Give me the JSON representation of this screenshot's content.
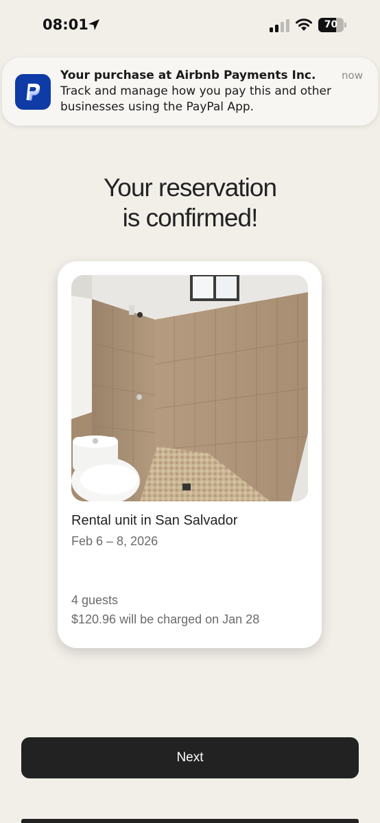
{
  "status_bar": {
    "time": "08:01",
    "battery_level": "70",
    "battery_fraction": 0.7
  },
  "notification": {
    "app": "PayPal",
    "title": "Your purchase at Airbnb Payments Inc.",
    "body": "Track and manage how you pay this and other businesses using the PayPal App.",
    "time": "now",
    "icon": "paypal-logo"
  },
  "heading": {
    "line1": "Your reservation",
    "line2": "is confirmed!"
  },
  "reservation": {
    "photo": "bathroom-shower-photo",
    "title": "Rental unit in San Salvador",
    "dates": "Feb 6 – 8, 2026",
    "guests": "4 guests",
    "charge": "$120.96 will be charged on Jan 28"
  },
  "actions": {
    "next_label": "Next"
  },
  "colors": {
    "background": "#f2efe9",
    "button": "#222222",
    "paypal_blue": "#0f3ba6"
  }
}
